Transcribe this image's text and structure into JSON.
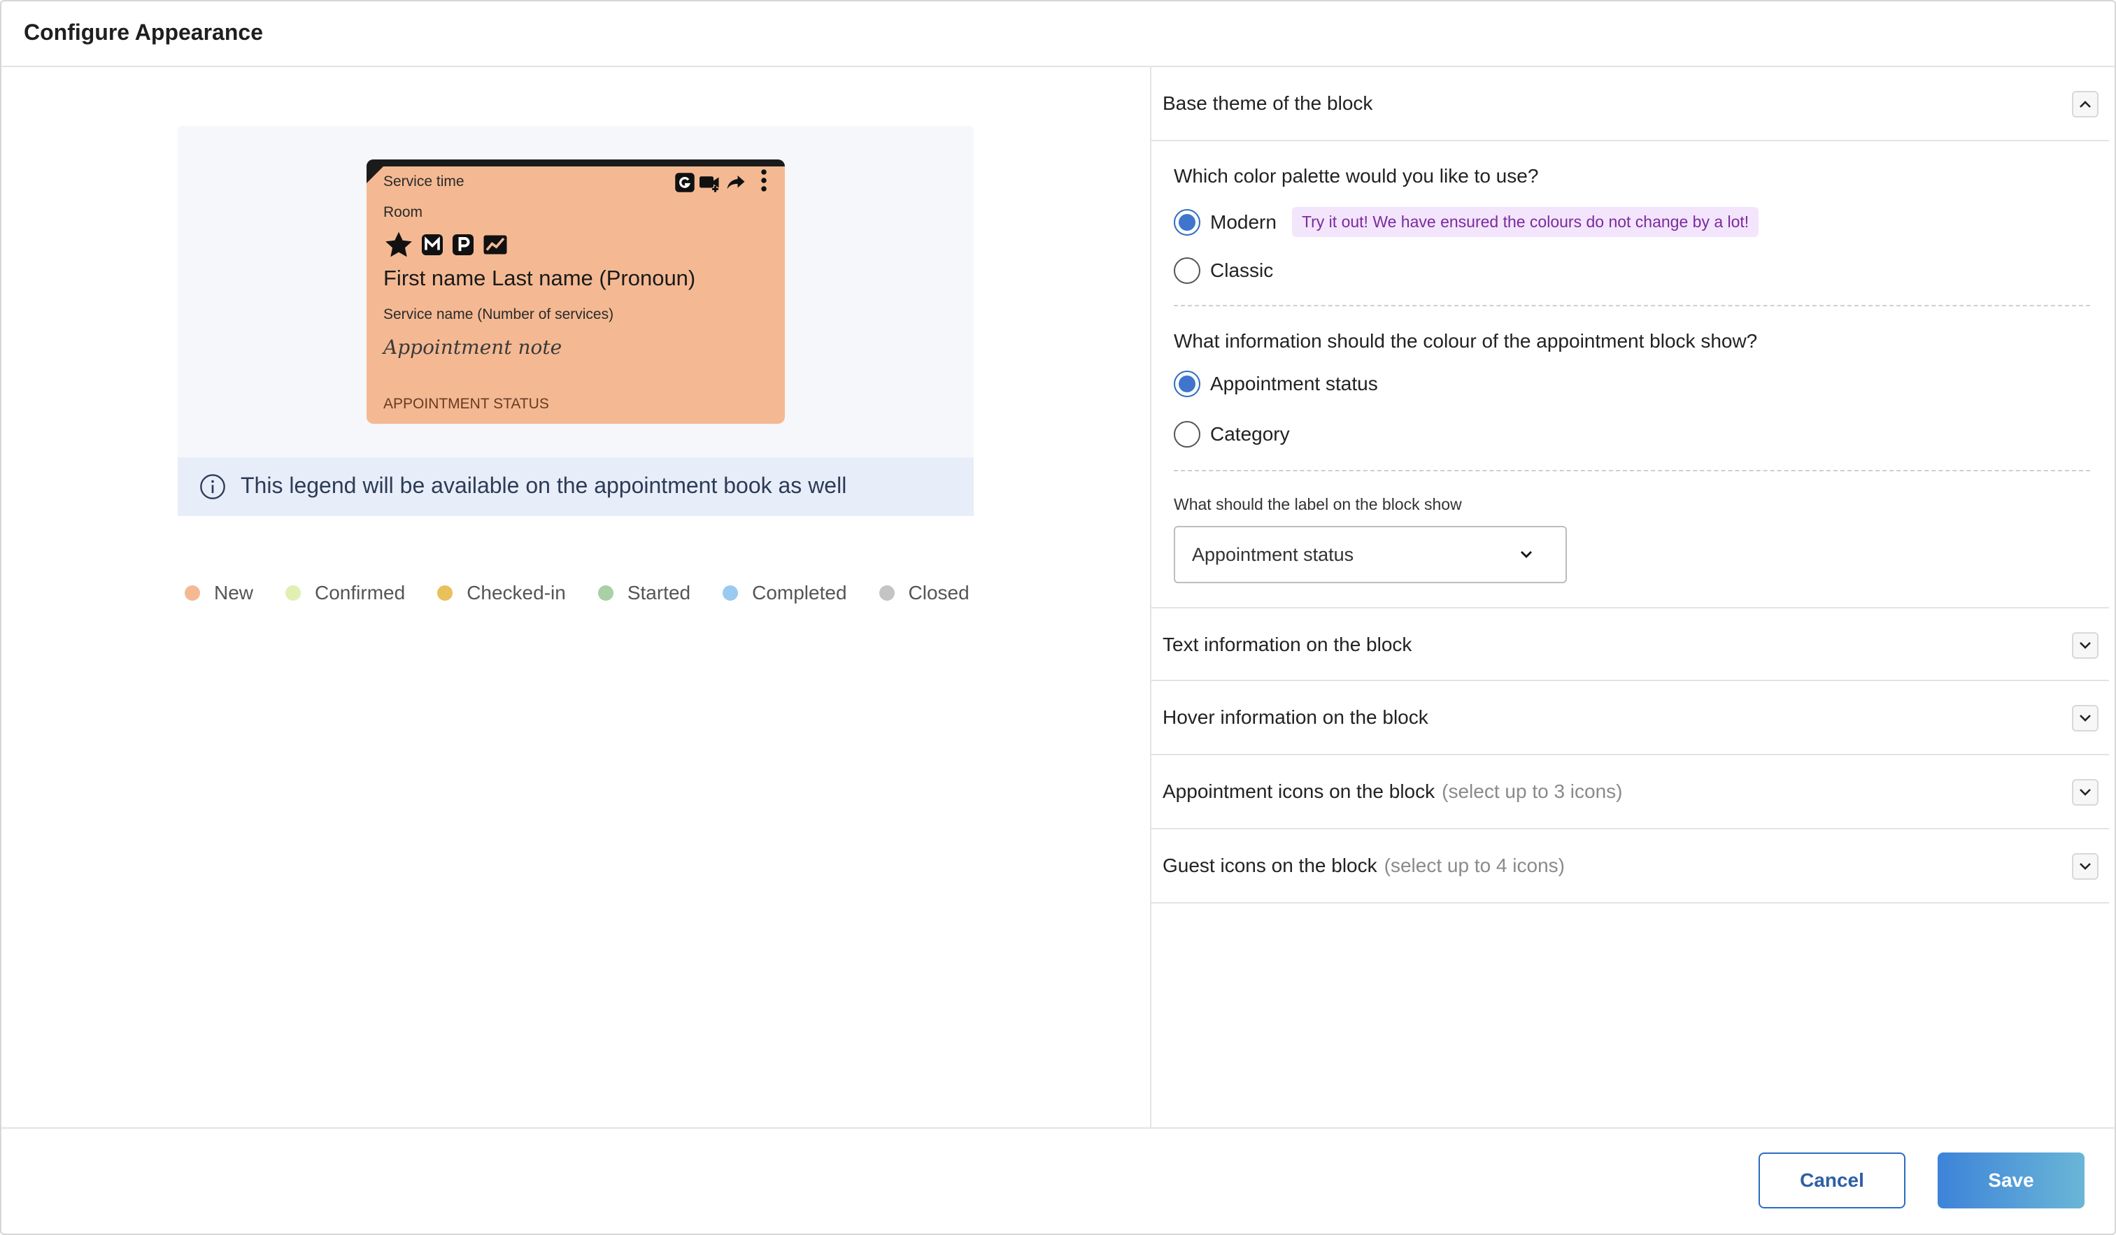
{
  "dialog": {
    "title": "Configure Appearance"
  },
  "preview": {
    "card": {
      "service_time": "Service time",
      "room": "Room",
      "name": "First name  Last name  (Pronoun)",
      "service": "Service name  (Number of services)",
      "note": "Appointment note",
      "status": "APPOINTMENT STATUS",
      "background_color": "#f4b993",
      "left_icons": [
        "star-icon",
        "m-badge-icon",
        "p-badge-icon",
        "trend-icon"
      ],
      "right_icons": [
        "g-badge-icon",
        "video-add-icon",
        "share-arrow-icon",
        "kebab-menu-icon"
      ]
    },
    "info_text": "This legend will be available on the appointment book as well",
    "legend": [
      {
        "label": "New",
        "color": "#f4b993"
      },
      {
        "label": "Confirmed",
        "color": "#e1efb3"
      },
      {
        "label": "Checked-in",
        "color": "#e9c05a"
      },
      {
        "label": "Started",
        "color": "#a9cfa6"
      },
      {
        "label": "Completed",
        "color": "#9bcaf0"
      },
      {
        "label": "Closed",
        "color": "#c4c4c4"
      }
    ]
  },
  "settings": {
    "base_theme": {
      "title": "Base theme of the block",
      "palette_question": "Which color palette would you like to use?",
      "palette_options": [
        {
          "label": "Modern",
          "checked": true
        },
        {
          "label": "Classic",
          "checked": false
        }
      ],
      "palette_tip": "Try it out! We have ensured the colours do not change by a lot!",
      "colour_question": "What information should the colour of the appointment block show?",
      "colour_options": [
        {
          "label": "Appointment status",
          "checked": true
        },
        {
          "label": "Category",
          "checked": false
        }
      ],
      "label_question": "What should the label on the block show",
      "label_value": "Appointment status"
    },
    "sections": [
      {
        "title": "Text information on the block",
        "hint": ""
      },
      {
        "title": "Hover information on the block",
        "hint": ""
      },
      {
        "title": "Appointment icons on the block",
        "hint": "(select up to 3 icons)"
      },
      {
        "title": "Guest icons on the block",
        "hint": "(select up to 4 icons)"
      }
    ]
  },
  "footer": {
    "cancel_label": "Cancel",
    "save_label": "Save"
  }
}
